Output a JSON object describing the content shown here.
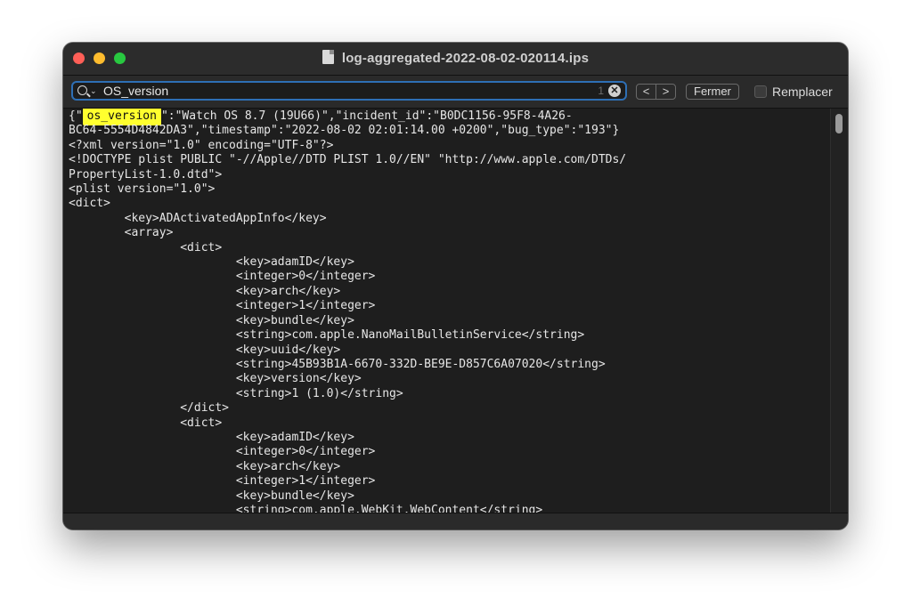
{
  "window": {
    "title": "log-aggregated-2022-08-02-020114.ips",
    "file_icon": "document-icon"
  },
  "findbar": {
    "search_value": "OS_version",
    "match_count": "1",
    "clear_glyph": "✕",
    "prev_glyph": "<",
    "next_glyph": ">",
    "close_label": "Fermer",
    "replace_label": "Remplacer"
  },
  "editor": {
    "first_line_prefix": "{\"",
    "highlight_text": "os_version",
    "first_line_rest": "\":\"Watch OS 8.7 (19U66)\",\"incident_id\":\"B0DC1156-95F8-4A26-",
    "lines": [
      "BC64-5554D4842DA3\",\"timestamp\":\"2022-08-02 02:01:14.00 +0200\",\"bug_type\":\"193\"}",
      "<?xml version=\"1.0\" encoding=\"UTF-8\"?>",
      "<!DOCTYPE plist PUBLIC \"-//Apple//DTD PLIST 1.0//EN\" \"http://www.apple.com/DTDs/",
      "PropertyList-1.0.dtd\">",
      "<plist version=\"1.0\">",
      "<dict>",
      "        <key>ADActivatedAppInfo</key>",
      "        <array>",
      "                <dict>",
      "                        <key>adamID</key>",
      "                        <integer>0</integer>",
      "                        <key>arch</key>",
      "                        <integer>1</integer>",
      "                        <key>bundle</key>",
      "                        <string>com.apple.NanoMailBulletinService</string>",
      "                        <key>uuid</key>",
      "                        <string>45B93B1A-6670-332D-BE9E-D857C6A07020</string>",
      "                        <key>version</key>",
      "                        <string>1 (1.0)</string>",
      "                </dict>",
      "                <dict>",
      "                        <key>adamID</key>",
      "                        <integer>0</integer>",
      "                        <key>arch</key>",
      "                        <integer>1</integer>",
      "                        <key>bundle</key>",
      "                        <string>com.apple.WebKit.WebContent</string>"
    ]
  },
  "colors": {
    "highlight": "#ffff2e",
    "search_focus": "#2e6fb5",
    "editor_bg": "#1e1e1e"
  }
}
